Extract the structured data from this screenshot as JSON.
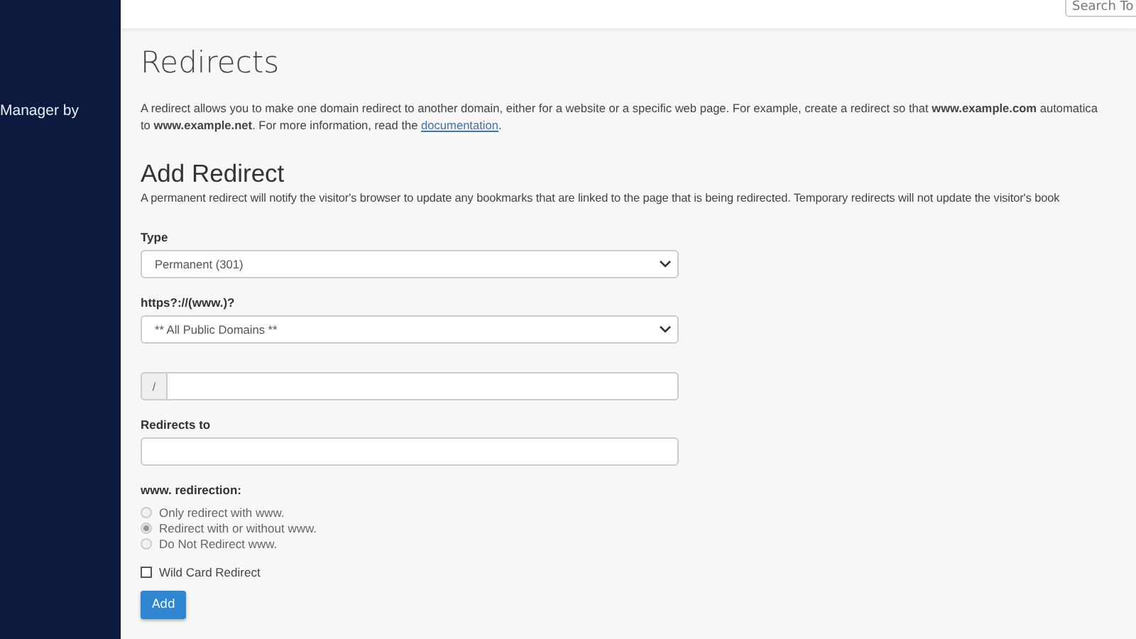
{
  "sidebar": {
    "brand_text": "Manager by"
  },
  "header": {
    "search": {
      "placeholder": "Search To"
    }
  },
  "page": {
    "title": "Redirects",
    "intro": {
      "line_1": "A redirect allows you to make one domain redirect to another domain, either for a website or a specific web page. For example, create a redirect so that **www.example.com** automatica",
      "line_2_before": "to **www.example.net**. For more information, read the ",
      "link": "documentation",
      "line_2_after": "."
    },
    "section_title": "Add Redirect",
    "section_note": "A permanent redirect will notify the visitor's browser to update any bookmarks that are linked to the page that is being redirected. Temporary redirects will not update the visitor's book",
    "type_field": {
      "label": "Type",
      "value": "Permanent (301)"
    },
    "domain_field": {
      "label": "https?://(www.)?",
      "value": "** All Public Domains **"
    },
    "path_field": {
      "prefix": "/"
    },
    "target_field": {
      "label": "Redirects to"
    },
    "www_redirection": {
      "label": "www. redirection:",
      "options": [
        {
          "label": "Only redirect with www.",
          "selected": false,
          "disabled": true
        },
        {
          "label": "Redirect with or without www.",
          "selected": true,
          "disabled": true
        },
        {
          "label": "Do Not Redirect www.",
          "selected": false,
          "disabled": true
        }
      ]
    },
    "wildcard": {
      "label": "Wild Card Redirect",
      "checked": false
    },
    "submit": "Add"
  }
}
